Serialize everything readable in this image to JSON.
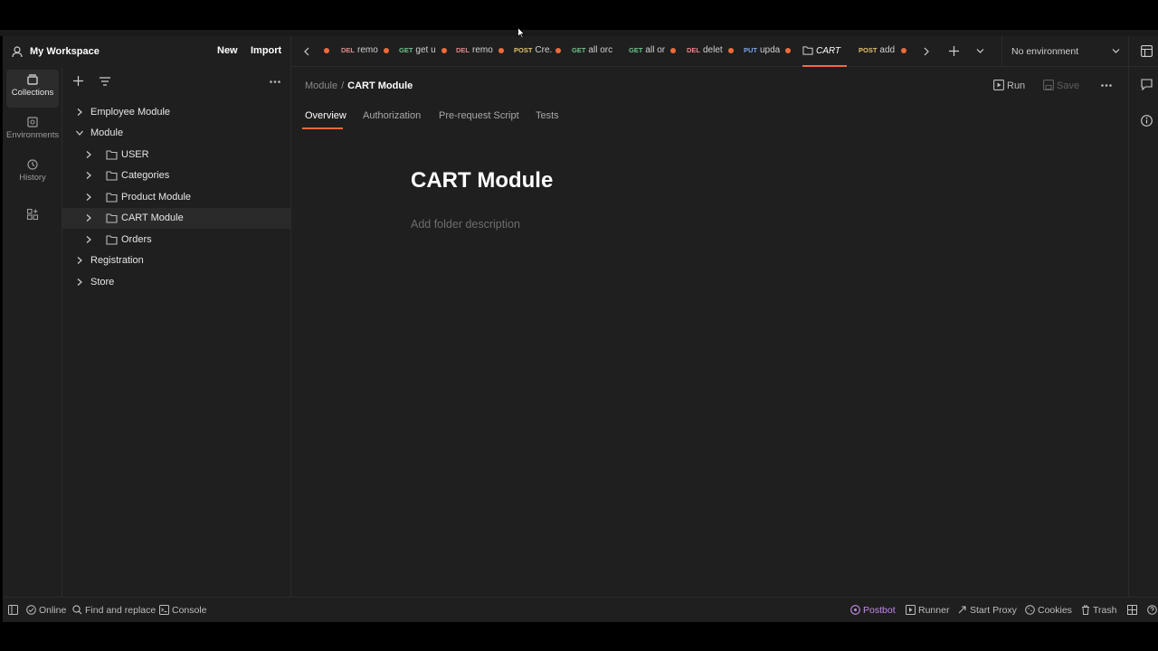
{
  "workspace": {
    "name": "My Workspace",
    "new_label": "New",
    "import_label": "Import"
  },
  "rail": [
    {
      "label": "Collections",
      "icon": "collections-icon"
    },
    {
      "label": "Environments",
      "icon": "environments-icon"
    },
    {
      "label": "History",
      "icon": "history-icon"
    }
  ],
  "tree": {
    "employee": "Employee Module",
    "module": "Module",
    "user": "USER",
    "categories": "Categories",
    "product": "Product Module",
    "cart": "CART Module",
    "orders": "Orders",
    "registration": "Registration",
    "store": "Store"
  },
  "tabs": [
    {
      "method": "DEL",
      "name": "remo"
    },
    {
      "method": "GET",
      "name": "get u"
    },
    {
      "method": "DEL",
      "name": "remo"
    },
    {
      "method": "POST",
      "name": "Cre."
    },
    {
      "method": "GET",
      "name": "all orc"
    },
    {
      "method": "GET",
      "name": "all or"
    },
    {
      "method": "DEL",
      "name": "delet"
    },
    {
      "method": "PUT",
      "name": "upda"
    },
    {
      "method": "",
      "name": "CART"
    },
    {
      "method": "POST",
      "name": "add"
    }
  ],
  "environment": "No environment",
  "breadcrumb": {
    "parent": "Module",
    "sep": "/",
    "current": "CART Module"
  },
  "actions": {
    "run": "Run",
    "save": "Save"
  },
  "subtabs": [
    "Overview",
    "Authorization",
    "Pre-request Script",
    "Tests"
  ],
  "page": {
    "title": "CART Module",
    "description_placeholder": "Add folder description"
  },
  "status": {
    "online": "Online",
    "find": "Find and replace",
    "console": "Console",
    "postbot": "Postbot",
    "runner": "Runner",
    "proxy": "Start Proxy",
    "cookies": "Cookies",
    "trash": "Trash"
  },
  "colors": {
    "accent": "#ef6b3a",
    "postbot": "#c38ae8"
  }
}
